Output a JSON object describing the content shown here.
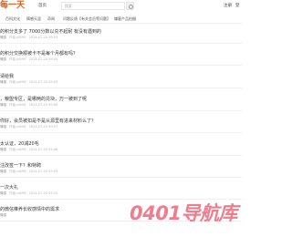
{
  "header": {
    "logo": "每一天",
    "home_label": "首页",
    "search_placeholder": "搜索",
    "right_a": "注册",
    "right_b": "登"
  },
  "nav": {
    "items": [
      "百科文化",
      "情感天涯",
      "奇闻",
      "问题反馈【有关会员等问题】",
      "赚客产品拍摄"
    ]
  },
  "posts": [
    {
      "title": "的积分支多了 7000分数以兑不起耐 有没有遇到的",
      "tag": "情感",
      "meta": "作者:ydt96 · 2024-07-20 09:03"
    },
    {
      "title": "的积分交换顺被卡不是每个月都有吗？",
      "tag": "情感",
      "meta": "作者:ydt96 · 2024-07-20 09:04"
    },
    {
      "title": "请给我",
      "tag": "情感",
      "meta": "作者:ydt96 · 2024-07-20 09:05"
    },
    {
      "title": "，粮盟专区，是哪两的兑块，万一被到了呢",
      "tag": "情感",
      "meta": "作者:ydt96 · 2024-07-20 09:06"
    },
    {
      "title": "你好，会员被扣是不是从源里有进来材料么了？",
      "tag": "情感",
      "meta": "作者:ydt96 · 2024-07-20 09:07"
    },
    {
      "title": "太认证，20减20毛",
      "tag": "情感",
      "meta": "作者:ydt96 · 2024-07-20 09:08"
    },
    {
      "title": "注改签一下？和特聘",
      "tag": "情感",
      "meta": "作者:ydt96 · 2024-07-20 09:09"
    },
    {
      "title": "一次大礼",
      "tag": "情感",
      "meta": "作者:ydt96 · 2024-07-20 09:10"
    },
    {
      "title": "的微信推养长收感情中的需求",
      "tag": "情感",
      "meta": ""
    }
  ],
  "watermark": "0401导航库"
}
